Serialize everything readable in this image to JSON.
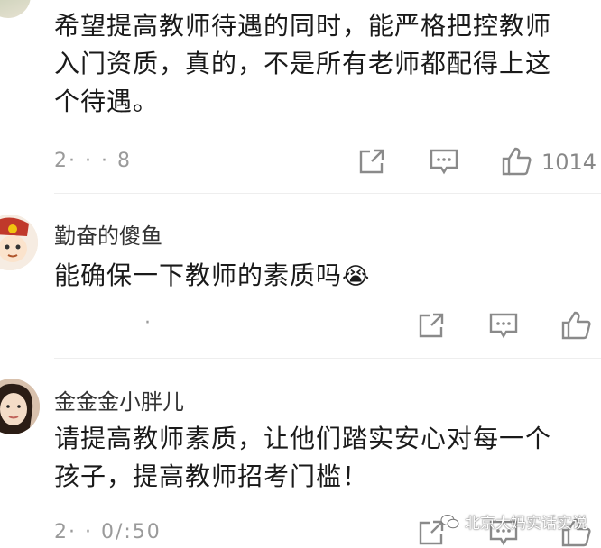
{
  "comments": [
    {
      "text_lines": [
        "希望提高教师待遇的同时，能严格把控教师",
        "入门资质，真的，不是所有老师都配得上这",
        "个待遇。"
      ],
      "timestamp": "2·  ·  ·  8",
      "like_count": "1014"
    },
    {
      "username": "勤奋的傻鱼",
      "text": "能确保一下教师的素质吗",
      "emoji": "😭",
      "timestamp": "·"
    },
    {
      "username": "金金金小胖儿",
      "text_lines": [
        "请提高教师素质，让他们踏实安心对每一个",
        "孩子，提高教师招考门槛！"
      ],
      "timestamp": "2·  · 0/:50"
    }
  ],
  "watermark": {
    "text": "北京大妈实话实说"
  }
}
